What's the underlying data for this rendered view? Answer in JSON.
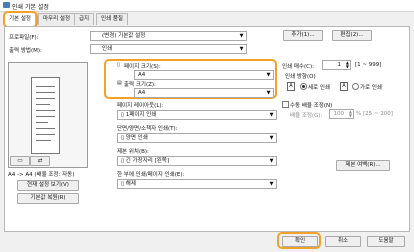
{
  "window": {
    "title": "인쇄 기본 설정"
  },
  "tabs": [
    "기본 설정",
    "마무리 설정",
    "급지",
    "인쇄 품질"
  ],
  "profile": {
    "label": "프로파일(F):",
    "value": "(변경) 기본값 설정",
    "add": "추가(1)...",
    "edit": "편집(2)..."
  },
  "output": {
    "label": "출력 방법(M):",
    "value": "인쇄"
  },
  "page_size": {
    "label": "페이지 크기(S):",
    "value": "A4"
  },
  "output_size": {
    "label": "출력 크기(Z):",
    "value": "A4"
  },
  "copies": {
    "label": "인쇄 매수(C):",
    "value": "1",
    "range": "[1 ~ 999]"
  },
  "orientation": {
    "label": "인쇄 방향(O)",
    "portrait": "세로 인쇄",
    "landscape": "가로 인쇄"
  },
  "layout": {
    "label": "페이지 레이아웃(L):",
    "value": "1페이지 인쇄"
  },
  "manual_scale": {
    "label": "수동 배율 조정(N)",
    "sub": "배율 조정(G):",
    "value": "100",
    "range": "% [25 ~ 200]"
  },
  "duplex": {
    "label": "단면/양면/소책자 인쇄(T):",
    "value": "양면 인쇄"
  },
  "binding": {
    "label": "제본 위치(B):",
    "value": "긴 가장자리 [왼쪽]",
    "margin_button": "제본 여백(R)..."
  },
  "saving": {
    "label": "한 부에 인쇄/페이지 인쇄(E):",
    "value": "해제"
  },
  "preview": {
    "caption": "A4 -> A4 (배율 조정: 자동)",
    "view_button": "현재 설정 보기(V)",
    "restore_button": "기본값 복원(R)"
  },
  "footer": {
    "ok": "확인",
    "cancel": "취소",
    "help": "도움말"
  }
}
